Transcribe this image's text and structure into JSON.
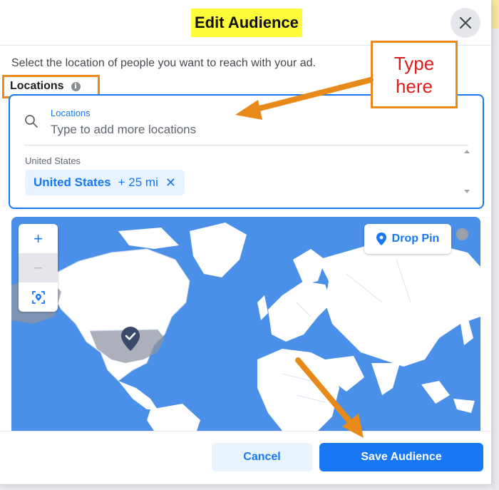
{
  "dialog": {
    "title": "Edit Audience",
    "subtitle": "Select the location of people you want to reach with your ad.",
    "close_icon": "close-icon"
  },
  "locations": {
    "label": "Locations",
    "info_icon": "info-icon",
    "search": {
      "caption": "Locations",
      "placeholder": "Type to add more locations",
      "icon": "search-icon"
    },
    "group_heading": "United States",
    "selected": [
      {
        "name": "United States",
        "radius": "+ 25 mi",
        "remove_glyph": "✕"
      }
    ]
  },
  "map": {
    "zoom_in": "+",
    "zoom_out": "−",
    "locate_icon": "locate-icon",
    "drop_pin_label": "Drop Pin",
    "drop_pin_icon": "map-pin-icon",
    "marker_icon": "check-marker-icon"
  },
  "footer": {
    "cancel_label": "Cancel",
    "save_label": "Save Audience"
  },
  "annotation": {
    "callout_line1": "Type",
    "callout_line2": "here"
  },
  "colors": {
    "accent": "#1877f2",
    "highlight": "#fdfd3c",
    "annotation_orange": "#e88a1a",
    "annotation_red": "#e01b1b",
    "ocean": "#4a8fe8",
    "land": "#ffffff"
  }
}
